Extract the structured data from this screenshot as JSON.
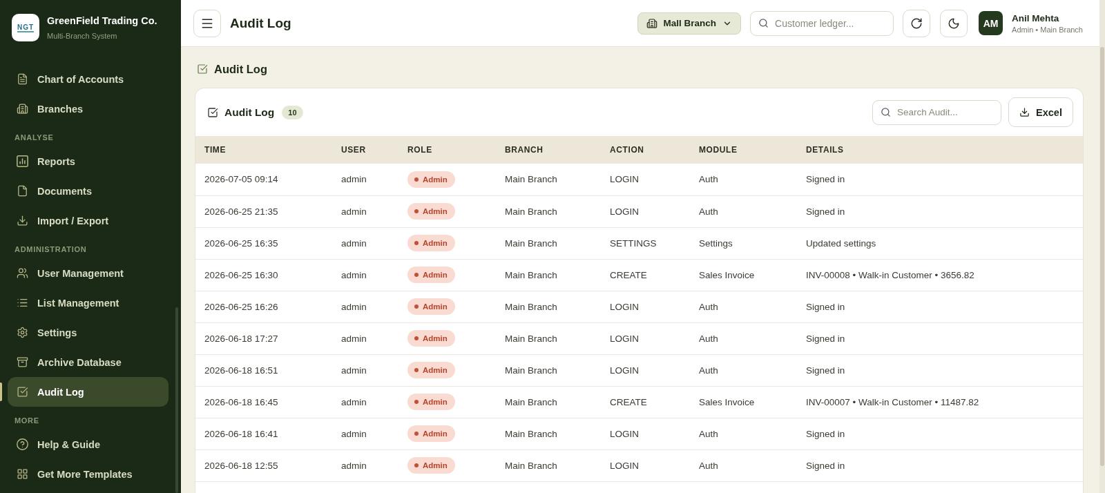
{
  "sidebar": {
    "brand": {
      "logo_text": "NGT",
      "name": "GreenField Trading Co.",
      "subtitle": "Multi-Branch System"
    },
    "sections": [
      {
        "items": [
          {
            "label": "Chart of Accounts",
            "selected": false
          },
          {
            "label": "Branches",
            "selected": false
          }
        ]
      },
      {
        "title": "ANALYSE",
        "items": [
          {
            "label": "Reports",
            "selected": false
          },
          {
            "label": "Documents",
            "selected": false
          },
          {
            "label": "Import / Export",
            "selected": false
          }
        ]
      },
      {
        "title": "ADMINISTRATION",
        "items": [
          {
            "label": "User Management",
            "selected": false
          },
          {
            "label": "List Management",
            "selected": false
          },
          {
            "label": "Settings",
            "selected": false
          },
          {
            "label": "Archive Database",
            "selected": false
          },
          {
            "label": "Audit Log",
            "selected": true
          }
        ]
      },
      {
        "title": "MORE",
        "items": [
          {
            "label": "Help & Guide",
            "selected": false
          },
          {
            "label": "Get More Templates",
            "selected": false
          }
        ]
      }
    ]
  },
  "header": {
    "title": "Audit Log",
    "branch_select": {
      "value": "Mall Branch"
    },
    "search": {
      "placeholder": "Customer ledger..."
    },
    "user": {
      "initials": "AM",
      "name": "Anil Mehta",
      "role": "Admin • Main Branch"
    }
  },
  "page": {
    "heading": "Audit Log",
    "card": {
      "title": "Audit Log",
      "count": "10",
      "search": {
        "placeholder": "Search Audit..."
      },
      "export_button": "Excel"
    },
    "table": {
      "columns": [
        "TIME",
        "USER",
        "ROLE",
        "BRANCH",
        "ACTION",
        "MODULE",
        "DETAILS"
      ],
      "rows": [
        {
          "time": "2026-07-05 09:14",
          "user": "admin",
          "role": "Admin",
          "branch": "Main Branch",
          "action": "LOGIN",
          "module": "Auth",
          "details": "Signed in"
        },
        {
          "time": "2026-06-25 21:35",
          "user": "admin",
          "role": "Admin",
          "branch": "Main Branch",
          "action": "LOGIN",
          "module": "Auth",
          "details": "Signed in"
        },
        {
          "time": "2026-06-25 16:35",
          "user": "admin",
          "role": "Admin",
          "branch": "Main Branch",
          "action": "SETTINGS",
          "module": "Settings",
          "details": "Updated settings"
        },
        {
          "time": "2026-06-25 16:30",
          "user": "admin",
          "role": "Admin",
          "branch": "Main Branch",
          "action": "CREATE",
          "module": "Sales Invoice",
          "details": "INV-00008 • Walk-in Customer • 3656.82"
        },
        {
          "time": "2026-06-25 16:26",
          "user": "admin",
          "role": "Admin",
          "branch": "Main Branch",
          "action": "LOGIN",
          "module": "Auth",
          "details": "Signed in"
        },
        {
          "time": "2026-06-18 17:27",
          "user": "admin",
          "role": "Admin",
          "branch": "Main Branch",
          "action": "LOGIN",
          "module": "Auth",
          "details": "Signed in"
        },
        {
          "time": "2026-06-18 16:51",
          "user": "admin",
          "role": "Admin",
          "branch": "Main Branch",
          "action": "LOGIN",
          "module": "Auth",
          "details": "Signed in"
        },
        {
          "time": "2026-06-18 16:45",
          "user": "admin",
          "role": "Admin",
          "branch": "Main Branch",
          "action": "CREATE",
          "module": "Sales Invoice",
          "details": "INV-00007 • Walk-in Customer • 11487.82"
        },
        {
          "time": "2026-06-18 16:41",
          "user": "admin",
          "role": "Admin",
          "branch": "Main Branch",
          "action": "LOGIN",
          "module": "Auth",
          "details": "Signed in"
        },
        {
          "time": "2026-06-18 12:55",
          "user": "admin",
          "role": "Admin",
          "branch": "Main Branch",
          "action": "LOGIN",
          "module": "Auth",
          "details": "Signed in"
        }
      ]
    }
  }
}
